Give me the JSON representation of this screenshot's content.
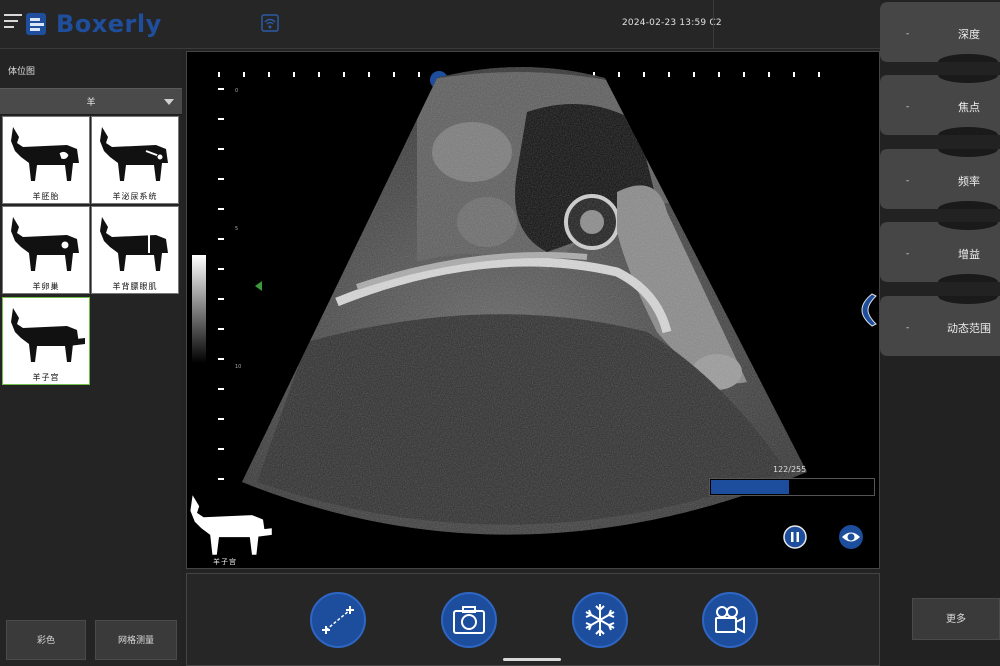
{
  "header": {
    "brand": "Boxerly",
    "datetime": "2024-02-23 13:59 C2"
  },
  "left_panel": {
    "title": "体位图",
    "species_select": "羊",
    "presets": [
      {
        "label": "羊胚胎",
        "selected": false
      },
      {
        "label": "羊泌尿系统",
        "selected": false
      },
      {
        "label": "羊卵巢",
        "selected": false
      },
      {
        "label": "羊背膘眼肌",
        "selected": false
      },
      {
        "label": "羊子宫",
        "selected": true
      }
    ],
    "bottom_buttons": [
      "彩色",
      "网格测量"
    ]
  },
  "image": {
    "depth_scale_labels": [
      "0",
      "5",
      "10"
    ],
    "progress": {
      "label": "122/255",
      "value": 122,
      "max": 255
    },
    "body_marker_label": "羊子宫"
  },
  "toolbar": {
    "icons": [
      "measure-icon",
      "camera-icon",
      "freeze-icon",
      "video-camera-icon"
    ]
  },
  "right_panel": {
    "params": [
      {
        "dash": "-",
        "label": "深度"
      },
      {
        "dash": "-",
        "label": "焦点"
      },
      {
        "dash": "-",
        "label": "频率"
      },
      {
        "dash": "-",
        "label": "增益"
      },
      {
        "dash": "-",
        "label": "动态范围"
      }
    ],
    "more_label": "更多"
  },
  "colors": {
    "accent": "#1d4e9e",
    "background": "#232323",
    "selected_outline": "#6fbf4a",
    "focus_marker": "#3a9a3a"
  }
}
